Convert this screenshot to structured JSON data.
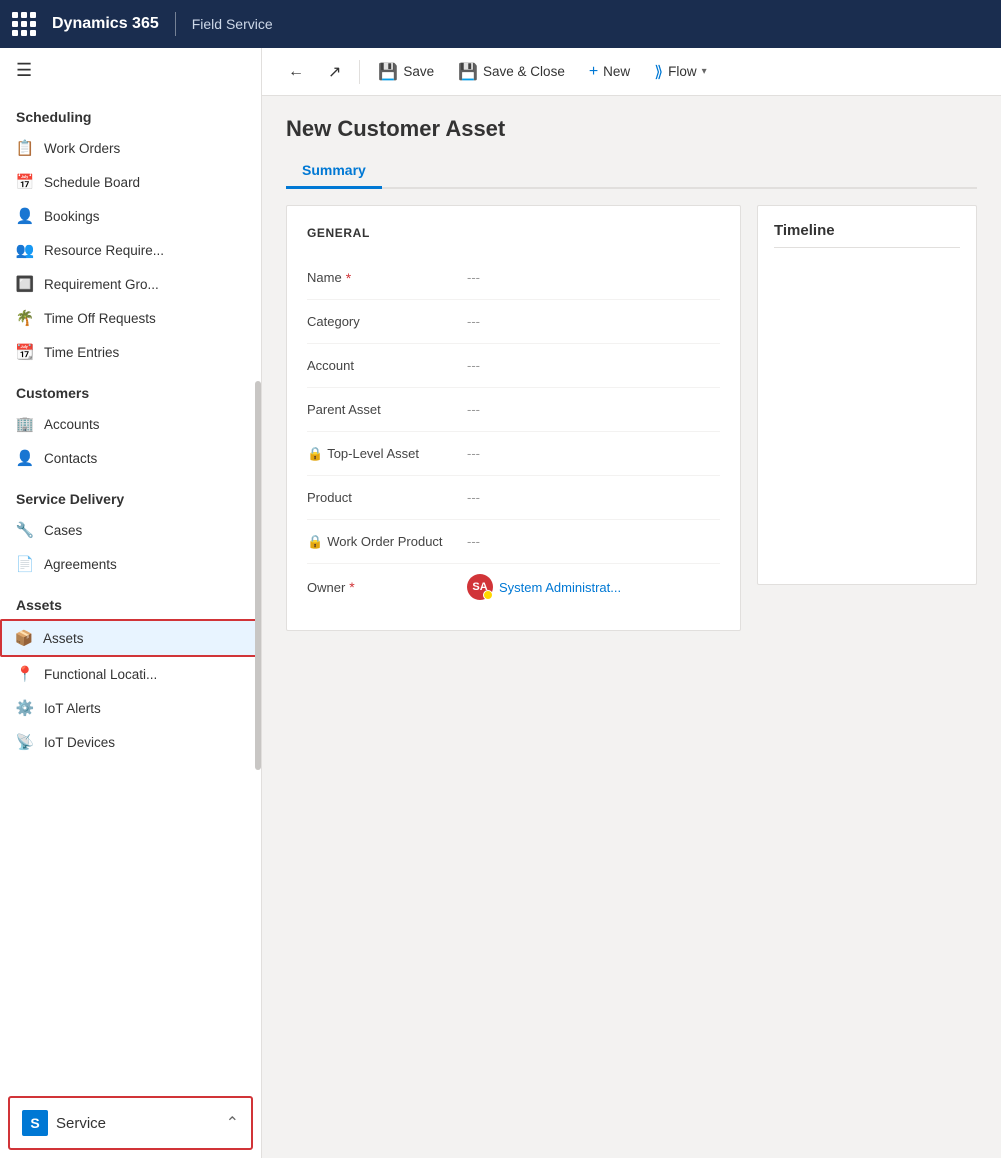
{
  "topbar": {
    "app_title": "Dynamics 365",
    "module_title": "Field Service"
  },
  "toolbar": {
    "back_label": "",
    "share_label": "",
    "save_label": "Save",
    "save_close_label": "Save & Close",
    "new_label": "New",
    "flow_label": "Flow"
  },
  "page": {
    "title": "New Customer Asset",
    "tabs": [
      {
        "label": "Summary",
        "active": true
      }
    ]
  },
  "form": {
    "section_title": "GENERAL",
    "fields": [
      {
        "label": "Name",
        "value": "---",
        "required": true,
        "locked": false
      },
      {
        "label": "Category",
        "value": "---",
        "required": false,
        "locked": false
      },
      {
        "label": "Account",
        "value": "---",
        "required": false,
        "locked": false
      },
      {
        "label": "Parent Asset",
        "value": "---",
        "required": false,
        "locked": false
      },
      {
        "label": "Top-Level Asset",
        "value": "---",
        "required": false,
        "locked": true
      },
      {
        "label": "Product",
        "value": "---",
        "required": false,
        "locked": false
      },
      {
        "label": "Work Order Product",
        "value": "---",
        "required": false,
        "locked": true
      },
      {
        "label": "Owner",
        "value": "System Administrat...",
        "required": true,
        "locked": false,
        "is_owner": true
      }
    ],
    "timeline_title": "Timeline"
  },
  "sidebar": {
    "scheduling_label": "Scheduling",
    "items_scheduling": [
      {
        "id": "work-orders",
        "label": "Work Orders",
        "icon": "📋"
      },
      {
        "id": "schedule-board",
        "label": "Schedule Board",
        "icon": "📅"
      },
      {
        "id": "bookings",
        "label": "Bookings",
        "icon": "👤"
      },
      {
        "id": "resource-requirements",
        "label": "Resource Require...",
        "icon": "👥"
      },
      {
        "id": "requirement-groups",
        "label": "Requirement Gro...",
        "icon": "🔲"
      },
      {
        "id": "time-off-requests",
        "label": "Time Off Requests",
        "icon": "🌴"
      },
      {
        "id": "time-entries",
        "label": "Time Entries",
        "icon": "📆"
      }
    ],
    "customers_label": "Customers",
    "items_customers": [
      {
        "id": "accounts",
        "label": "Accounts",
        "icon": "🏢"
      },
      {
        "id": "contacts",
        "label": "Contacts",
        "icon": "👤"
      }
    ],
    "service_delivery_label": "Service Delivery",
    "items_service_delivery": [
      {
        "id": "cases",
        "label": "Cases",
        "icon": "🔧"
      },
      {
        "id": "agreements",
        "label": "Agreements",
        "icon": "📄"
      }
    ],
    "assets_label": "Assets",
    "items_assets": [
      {
        "id": "assets",
        "label": "Assets",
        "icon": "📦",
        "active": true
      },
      {
        "id": "functional-locations",
        "label": "Functional Locati...",
        "icon": "📍"
      },
      {
        "id": "iot-alerts",
        "label": "IoT Alerts",
        "icon": "⚙️"
      },
      {
        "id": "iot-devices",
        "label": "IoT Devices",
        "icon": "📡"
      }
    ],
    "service_bottom": {
      "label": "Service",
      "badge": "S"
    }
  }
}
